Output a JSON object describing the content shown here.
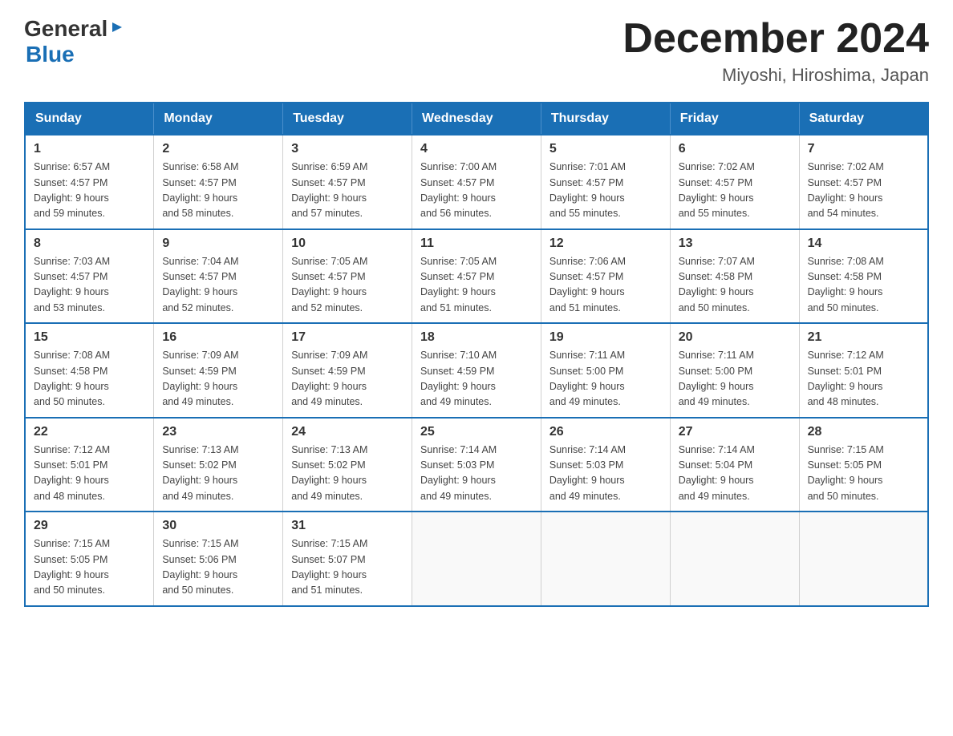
{
  "header": {
    "logo": {
      "general": "General",
      "blue": "Blue"
    },
    "title": "December 2024",
    "location": "Miyoshi, Hiroshima, Japan"
  },
  "calendar": {
    "weekdays": [
      "Sunday",
      "Monday",
      "Tuesday",
      "Wednesday",
      "Thursday",
      "Friday",
      "Saturday"
    ],
    "weeks": [
      [
        {
          "day": "1",
          "sunrise": "6:57 AM",
          "sunset": "4:57 PM",
          "daylight": "9 hours and 59 minutes."
        },
        {
          "day": "2",
          "sunrise": "6:58 AM",
          "sunset": "4:57 PM",
          "daylight": "9 hours and 58 minutes."
        },
        {
          "day": "3",
          "sunrise": "6:59 AM",
          "sunset": "4:57 PM",
          "daylight": "9 hours and 57 minutes."
        },
        {
          "day": "4",
          "sunrise": "7:00 AM",
          "sunset": "4:57 PM",
          "daylight": "9 hours and 56 minutes."
        },
        {
          "day": "5",
          "sunrise": "7:01 AM",
          "sunset": "4:57 PM",
          "daylight": "9 hours and 55 minutes."
        },
        {
          "day": "6",
          "sunrise": "7:02 AM",
          "sunset": "4:57 PM",
          "daylight": "9 hours and 55 minutes."
        },
        {
          "day": "7",
          "sunrise": "7:02 AM",
          "sunset": "4:57 PM",
          "daylight": "9 hours and 54 minutes."
        }
      ],
      [
        {
          "day": "8",
          "sunrise": "7:03 AM",
          "sunset": "4:57 PM",
          "daylight": "9 hours and 53 minutes."
        },
        {
          "day": "9",
          "sunrise": "7:04 AM",
          "sunset": "4:57 PM",
          "daylight": "9 hours and 52 minutes."
        },
        {
          "day": "10",
          "sunrise": "7:05 AM",
          "sunset": "4:57 PM",
          "daylight": "9 hours and 52 minutes."
        },
        {
          "day": "11",
          "sunrise": "7:05 AM",
          "sunset": "4:57 PM",
          "daylight": "9 hours and 51 minutes."
        },
        {
          "day": "12",
          "sunrise": "7:06 AM",
          "sunset": "4:57 PM",
          "daylight": "9 hours and 51 minutes."
        },
        {
          "day": "13",
          "sunrise": "7:07 AM",
          "sunset": "4:58 PM",
          "daylight": "9 hours and 50 minutes."
        },
        {
          "day": "14",
          "sunrise": "7:08 AM",
          "sunset": "4:58 PM",
          "daylight": "9 hours and 50 minutes."
        }
      ],
      [
        {
          "day": "15",
          "sunrise": "7:08 AM",
          "sunset": "4:58 PM",
          "daylight": "9 hours and 50 minutes."
        },
        {
          "day": "16",
          "sunrise": "7:09 AM",
          "sunset": "4:59 PM",
          "daylight": "9 hours and 49 minutes."
        },
        {
          "day": "17",
          "sunrise": "7:09 AM",
          "sunset": "4:59 PM",
          "daylight": "9 hours and 49 minutes."
        },
        {
          "day": "18",
          "sunrise": "7:10 AM",
          "sunset": "4:59 PM",
          "daylight": "9 hours and 49 minutes."
        },
        {
          "day": "19",
          "sunrise": "7:11 AM",
          "sunset": "5:00 PM",
          "daylight": "9 hours and 49 minutes."
        },
        {
          "day": "20",
          "sunrise": "7:11 AM",
          "sunset": "5:00 PM",
          "daylight": "9 hours and 49 minutes."
        },
        {
          "day": "21",
          "sunrise": "7:12 AM",
          "sunset": "5:01 PM",
          "daylight": "9 hours and 48 minutes."
        }
      ],
      [
        {
          "day": "22",
          "sunrise": "7:12 AM",
          "sunset": "5:01 PM",
          "daylight": "9 hours and 48 minutes."
        },
        {
          "day": "23",
          "sunrise": "7:13 AM",
          "sunset": "5:02 PM",
          "daylight": "9 hours and 49 minutes."
        },
        {
          "day": "24",
          "sunrise": "7:13 AM",
          "sunset": "5:02 PM",
          "daylight": "9 hours and 49 minutes."
        },
        {
          "day": "25",
          "sunrise": "7:14 AM",
          "sunset": "5:03 PM",
          "daylight": "9 hours and 49 minutes."
        },
        {
          "day": "26",
          "sunrise": "7:14 AM",
          "sunset": "5:03 PM",
          "daylight": "9 hours and 49 minutes."
        },
        {
          "day": "27",
          "sunrise": "7:14 AM",
          "sunset": "5:04 PM",
          "daylight": "9 hours and 49 minutes."
        },
        {
          "day": "28",
          "sunrise": "7:15 AM",
          "sunset": "5:05 PM",
          "daylight": "9 hours and 50 minutes."
        }
      ],
      [
        {
          "day": "29",
          "sunrise": "7:15 AM",
          "sunset": "5:05 PM",
          "daylight": "9 hours and 50 minutes."
        },
        {
          "day": "30",
          "sunrise": "7:15 AM",
          "sunset": "5:06 PM",
          "daylight": "9 hours and 50 minutes."
        },
        {
          "day": "31",
          "sunrise": "7:15 AM",
          "sunset": "5:07 PM",
          "daylight": "9 hours and 51 minutes."
        },
        null,
        null,
        null,
        null
      ]
    ]
  }
}
